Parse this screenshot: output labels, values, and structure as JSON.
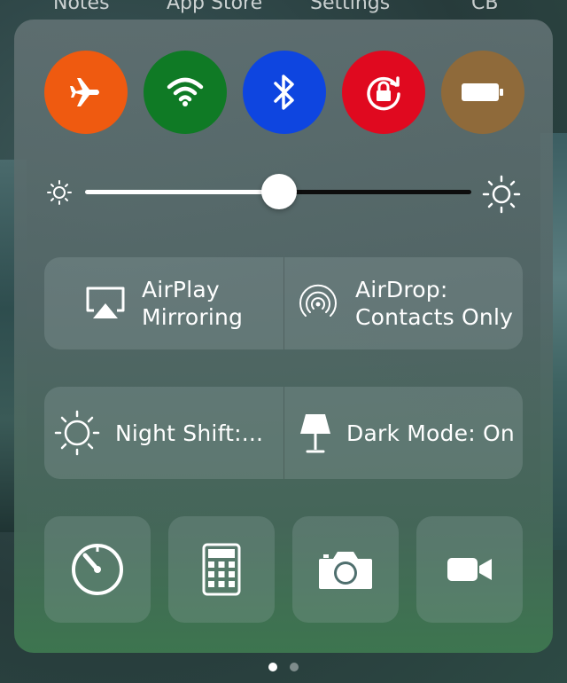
{
  "home_screen": {
    "labels": [
      "Notes",
      "App Store",
      "Settings",
      "CB"
    ]
  },
  "control_center": {
    "toggles": [
      {
        "name": "airplane-mode",
        "icon": "airplane-icon",
        "color": "#ef5a10"
      },
      {
        "name": "wifi",
        "icon": "wifi-icon",
        "color": "#0f7a25"
      },
      {
        "name": "bluetooth",
        "icon": "bluetooth-icon",
        "color": "#0e45e0"
      },
      {
        "name": "rotation-lock",
        "icon": "rotation-lock-icon",
        "color": "#e0091f"
      },
      {
        "name": "battery",
        "icon": "battery-icon",
        "color": "#8f6a3a"
      }
    ],
    "brightness": {
      "level": 0.5,
      "min_icon": "sun-small-icon",
      "max_icon": "sun-large-icon"
    },
    "airplay": {
      "label_line1": "AirPlay",
      "label_line2": "Mirroring",
      "icon": "airplay-icon"
    },
    "airdrop": {
      "label_line1": "AirDrop:",
      "label_line2": "Contacts Only",
      "icon": "airdrop-icon"
    },
    "night_shift": {
      "label": "Night Shift:...",
      "icon": "night-shift-icon"
    },
    "dark_mode": {
      "label": "Dark Mode: On",
      "icon": "lamp-icon"
    },
    "shortcuts": [
      {
        "name": "timer",
        "icon": "timer-icon"
      },
      {
        "name": "calculator",
        "icon": "calculator-icon"
      },
      {
        "name": "camera",
        "icon": "camera-icon"
      },
      {
        "name": "video",
        "icon": "video-camera-icon"
      }
    ]
  },
  "page_indicator": {
    "current": 1,
    "total": 2
  }
}
